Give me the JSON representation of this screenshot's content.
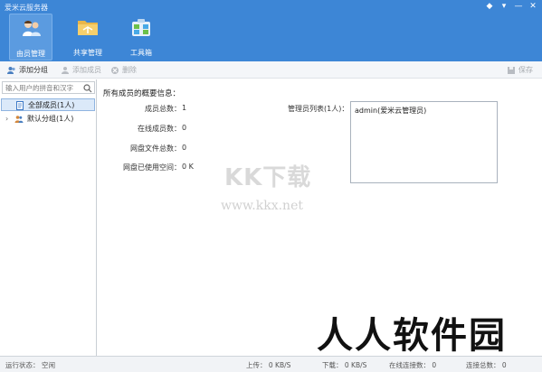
{
  "app": {
    "title": "爱米云服务器",
    "controls": [
      "◆",
      "▾",
      "—",
      "✕"
    ]
  },
  "nav": [
    {
      "label": "由员管理",
      "icon": "users-icon",
      "active": true
    },
    {
      "label": "共享管理",
      "icon": "shared-folder-icon",
      "active": false
    },
    {
      "label": "工具箱",
      "icon": "toolbox-icon",
      "active": false
    }
  ],
  "toolbar": {
    "add_group": "添加分组",
    "add_member": "添加成员",
    "delete": "删除",
    "save": "保存"
  },
  "sidebar": {
    "search_placeholder": "输入用户的拼音和汉字",
    "items": [
      {
        "label": "全部成员(1人)",
        "selected": true
      },
      {
        "label": "默认分组(1人)",
        "selected": false
      }
    ]
  },
  "main": {
    "section_title": "所有成员的概要信息：",
    "stats": [
      {
        "label": "成员总数：",
        "value": "1"
      },
      {
        "label": "在线成员数：",
        "value": "0"
      },
      {
        "label": "网盘文件总数：",
        "value": "0"
      },
      {
        "label": "网盘已使用空间：",
        "value": "0 K"
      }
    ],
    "admin_label": "管理员列表(1人)：",
    "admins": [
      "admin(爱米云管理员)"
    ]
  },
  "watermarks": {
    "kk": "KK下载",
    "url": "www.kkx.net",
    "rr": "人人软件园"
  },
  "status": {
    "run_label": "运行状态：",
    "run_value": "空闲",
    "upload": "上传：  0 KB/S",
    "download": "下载：  0 KB/S",
    "online_conn": "在线连接数：  0",
    "total_conn": "连接总数：  0"
  },
  "colors": {
    "titlebar": "#3d86d6",
    "accent": "#5b9be0",
    "status_ok": "#2a9d2a"
  }
}
